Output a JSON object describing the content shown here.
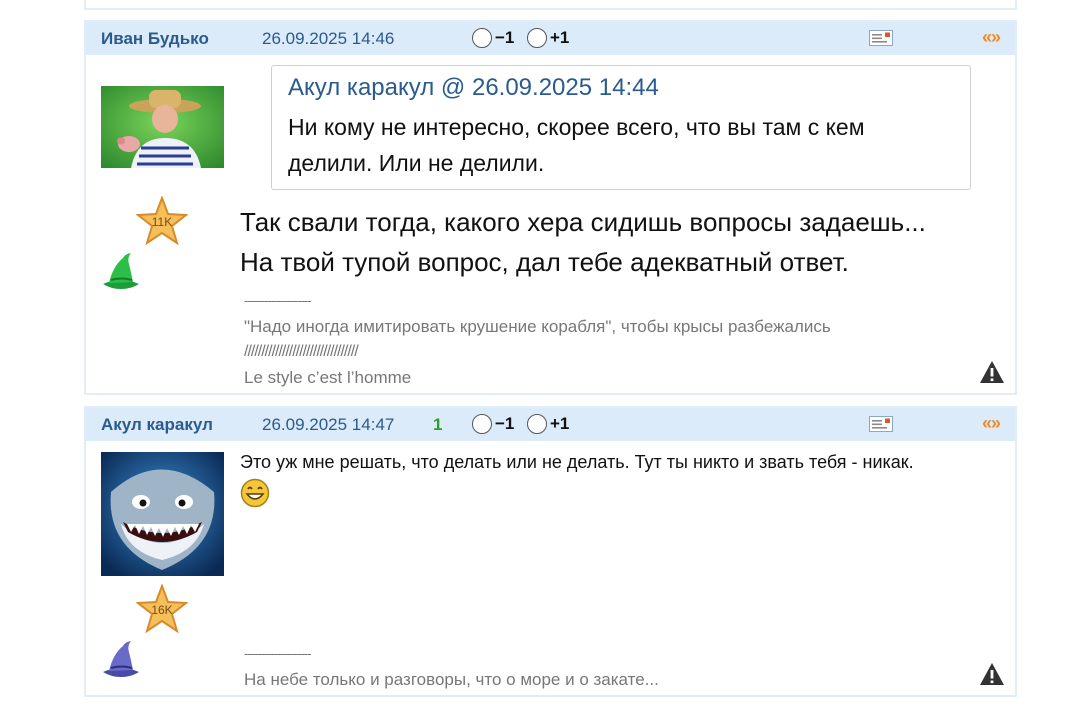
{
  "posts": [
    {
      "author": "Иван Будько",
      "date": "26.09.2025 14:46",
      "score": "",
      "vote_minus": "−1",
      "vote_plus": "+1",
      "quote_action": "«»",
      "rank": "11K",
      "quote": {
        "author": "Акул каракул",
        "at": "@",
        "date": "26.09.2025 14:44",
        "lines": [
          "Ни кому не интересно, скорее всего, что вы там с кем",
          "делили. Или не делили."
        ]
      },
      "body_lines": [
        "Так свали тогда, какого хера сидишь вопросы задаешь...",
        "На твой тупой вопрос, дал тебе адекватный ответ."
      ],
      "signature": {
        "dashes": "--------------------",
        "line1": "\"Надо иногда имитировать крушение корабля\", чтобы крысы разбежались",
        "slashes": "/////////////////////////////////",
        "line2": "Le style c’est l’homme"
      },
      "hat_color": "#1e9e3a"
    },
    {
      "author": "Акул каракул",
      "date": "26.09.2025 14:47",
      "score": "1",
      "vote_minus": "−1",
      "vote_plus": "+1",
      "quote_action": "«»",
      "rank": "16K",
      "body_lines": [
        "Это уж мне решать, что делать или не делать. Тут ты никто и звать тебя - никак."
      ],
      "signature": {
        "dashes": "--------------------",
        "line1": "На небе только и разговоры, что о море и о закате..."
      },
      "hat_color": "#4a4aa8"
    }
  ],
  "colors": {
    "header_bg": "#dcebfa",
    "author": "#2a5a8e",
    "score": "#2aa12a",
    "quote_action": "#f08a24",
    "border": "#e3edf7"
  },
  "icons": [
    "message-icon",
    "quote-icon",
    "warning-icon",
    "star-rank-icon",
    "wizard-hat-icon",
    "smiley-icon"
  ]
}
